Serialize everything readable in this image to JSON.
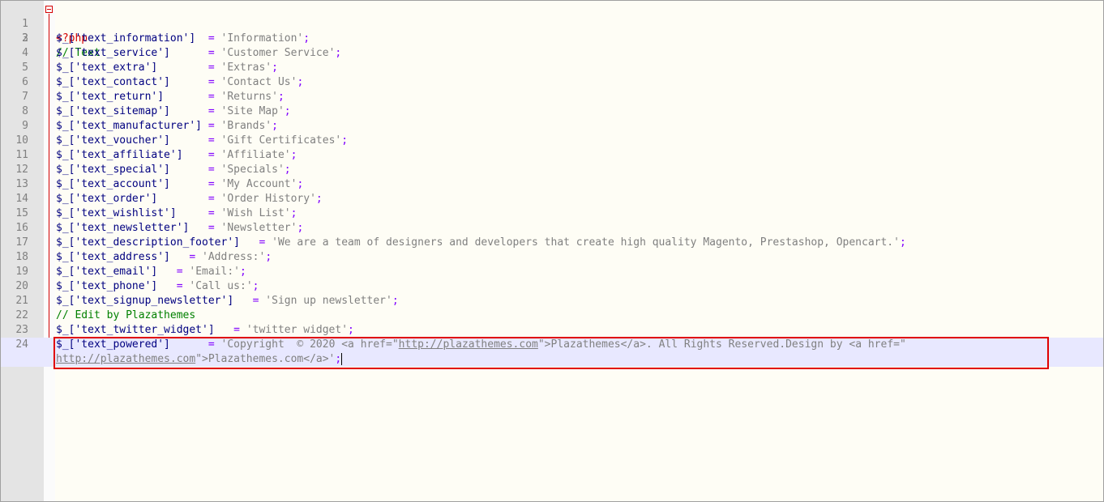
{
  "editor": {
    "open_tag": "<?php",
    "comment_text": "// Text",
    "comment_edit": "// Edit by Plazathemes"
  },
  "entries": [
    {
      "key": "$_['text_information']",
      "pad": "  ",
      "value": "'Information'"
    },
    {
      "key": "$_['text_service']",
      "pad": "      ",
      "value": "'Customer Service'"
    },
    {
      "key": "$_['text_extra']",
      "pad": "        ",
      "value": "'Extras'"
    },
    {
      "key": "$_['text_contact']",
      "pad": "      ",
      "value": "'Contact Us'"
    },
    {
      "key": "$_['text_return']",
      "pad": "       ",
      "value": "'Returns'"
    },
    {
      "key": "$_['text_sitemap']",
      "pad": "      ",
      "value": "'Site Map'"
    },
    {
      "key": "$_['text_manufacturer']",
      "pad": " ",
      "value": "'Brands'"
    },
    {
      "key": "$_['text_voucher']",
      "pad": "      ",
      "value": "'Gift Certificates'"
    },
    {
      "key": "$_['text_affiliate']",
      "pad": "    ",
      "value": "'Affiliate'"
    },
    {
      "key": "$_['text_special']",
      "pad": "      ",
      "value": "'Specials'"
    },
    {
      "key": "$_['text_account']",
      "pad": "      ",
      "value": "'My Account'"
    },
    {
      "key": "$_['text_order']",
      "pad": "        ",
      "value": "'Order History'"
    },
    {
      "key": "$_['text_wishlist']",
      "pad": "     ",
      "value": "'Wish List'"
    },
    {
      "key": "$_['text_newsletter']",
      "pad": "   ",
      "value": "'Newsletter'"
    },
    {
      "key": "$_['text_description_footer']",
      "pad": "   ",
      "value": "'We are a team of designers and developers that create high quality Magento, Prestashop, Opencart.'"
    },
    {
      "key": "$_['text_address']",
      "pad": "   ",
      "value": "'Address:'"
    },
    {
      "key": "$_['text_email']",
      "pad": "   ",
      "value": "'Email:'"
    },
    {
      "key": "$_['text_phone']",
      "pad": "   ",
      "value": "'Call us:'"
    },
    {
      "key": "$_['text_signup_newsletter']",
      "pad": "   ",
      "value": "'Sign up newsletter'"
    },
    {
      "key": "$_['text_twitter_widget']",
      "pad": "   ",
      "value": "'twitter widget'"
    }
  ],
  "powered": {
    "key": "$_['text_powered']",
    "pad": "      ",
    "part1": "'Copyright  © 2020 <a href=\"",
    "link1": "http://plazathemes.com",
    "part2": "\">Plazathemes</a>. All Rights Reserved.Design by <a href=\"",
    "link2": "http://plazathemes.com",
    "part3": "\">Plazathemes.com</a>'"
  },
  "symbols": {
    "assign": "= ",
    "semicolon": ";"
  },
  "line_numbers": [
    "1",
    "2",
    "3",
    "4",
    "5",
    "6",
    "7",
    "8",
    "9",
    "10",
    "11",
    "12",
    "13",
    "14",
    "15",
    "16",
    "17",
    "18",
    "19",
    "20",
    "21",
    "22",
    "23",
    "24"
  ]
}
